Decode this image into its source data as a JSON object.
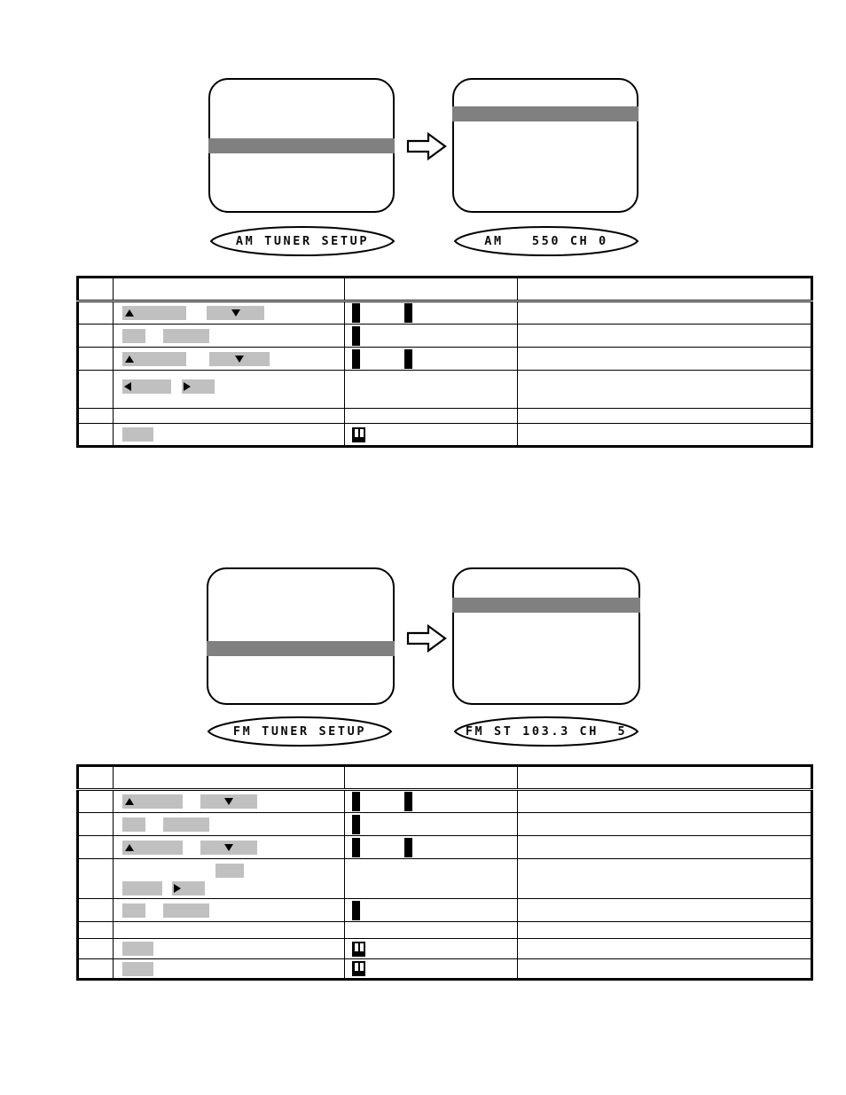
{
  "document": {
    "type": "product-manual-page",
    "background": "#ffffff",
    "accent_gray": "#808080",
    "redaction_gray": "#c0c0c0",
    "line_color": "#000000"
  },
  "sections": [
    {
      "id": "am-tuner",
      "osd": {
        "before": {
          "name": "am-menu-screen-before",
          "screen_lines": [],
          "highlight_bar": {
            "position": "middle",
            "color": "#808080"
          },
          "lcd_readout": "AM TUNER SETUP"
        },
        "transition_icon": "right-arrow-icon",
        "after": {
          "name": "am-menu-screen-after",
          "screen_lines": [],
          "highlight_bar": {
            "position": "upper",
            "color": "#808080"
          },
          "lcd_readout": "AM   550 CH 0"
        }
      },
      "table": {
        "name": "am-tuner-step-table",
        "columns": [
          "",
          "",
          "",
          ""
        ],
        "header": {
          "num": "",
          "action": "",
          "key": "",
          "note": ""
        },
        "rows": [
          {
            "num": "",
            "action": "",
            "key": "",
            "note": "",
            "action_glyphs": [
              "tri-up",
              "blank-wide",
              "tri-down",
              "blank-wide"
            ],
            "key_glyphs": [
              "bar",
              "gap",
              "bar"
            ]
          },
          {
            "num": "",
            "action": "",
            "key": "",
            "note": "",
            "action_glyphs": [
              "blank-small",
              "blank-med"
            ],
            "key_glyphs": [
              "bar"
            ]
          },
          {
            "num": "",
            "action": "",
            "key": "",
            "note": "",
            "action_glyphs": [
              "tri-up",
              "blank-wide",
              "tri-down",
              "blank-wide"
            ],
            "key_glyphs": [
              "bar",
              "gap",
              "bar"
            ]
          },
          {
            "num": "",
            "action": "",
            "key": "",
            "note": "",
            "action_glyphs": [
              "tri-left",
              "blank-med",
              "tri-right",
              "blank-small"
            ],
            "key_glyphs": []
          },
          {
            "num": "",
            "action": "",
            "key": "",
            "note": "",
            "action_glyphs": [],
            "key_glyphs": []
          },
          {
            "num": "",
            "action": "",
            "key": "",
            "note": "",
            "action_glyphs": [
              "blank-small"
            ],
            "key_glyphs": [
              "button"
            ]
          }
        ]
      }
    },
    {
      "id": "fm-tuner",
      "osd": {
        "before": {
          "name": "fm-menu-screen-before",
          "screen_lines": [],
          "highlight_bar": {
            "position": "middle",
            "color": "#808080"
          },
          "lcd_readout": "FM TUNER SETUP"
        },
        "transition_icon": "right-arrow-icon",
        "after": {
          "name": "fm-menu-screen-after",
          "screen_lines": [],
          "highlight_bar": {
            "position": "upper",
            "color": "#808080"
          },
          "lcd_readout": "FM ST 103.3 CH  5"
        }
      },
      "table": {
        "name": "fm-tuner-step-table",
        "columns": [
          "",
          "",
          "",
          ""
        ],
        "header": {
          "num": "",
          "action": "",
          "key": "",
          "note": ""
        },
        "rows": [
          {
            "num": "",
            "action": "",
            "key": "",
            "note": "",
            "action_glyphs": [
              "tri-up",
              "blank-wide",
              "tri-down",
              "blank-wide"
            ],
            "key_glyphs": [
              "bar",
              "gap",
              "bar"
            ]
          },
          {
            "num": "",
            "action": "",
            "key": "",
            "note": "",
            "action_glyphs": [
              "blank-small",
              "blank-med"
            ],
            "key_glyphs": [
              "bar"
            ]
          },
          {
            "num": "",
            "action": "",
            "key": "",
            "note": "",
            "action_glyphs": [
              "tri-up",
              "blank-wide",
              "tri-down",
              "blank-wide"
            ],
            "key_glyphs": [
              "bar",
              "gap",
              "bar"
            ]
          },
          {
            "num": "",
            "action": "",
            "key": "",
            "note": "",
            "action_glyphs": [
              "blank-small-offset",
              "blank-med",
              "tri-right",
              "blank-small"
            ],
            "key_glyphs": []
          },
          {
            "num": "",
            "action": "",
            "key": "",
            "note": "",
            "action_glyphs": [
              "blank-small",
              "blank-med"
            ],
            "key_glyphs": [
              "bar"
            ]
          },
          {
            "num": "",
            "action": "",
            "key": "",
            "note": "",
            "action_glyphs": [],
            "key_glyphs": []
          },
          {
            "num": "",
            "action": "",
            "key": "",
            "note": "",
            "action_glyphs": [
              "blank-small"
            ],
            "key_glyphs": [
              "button"
            ]
          },
          {
            "num": "",
            "action": "",
            "key": "",
            "note": "",
            "action_glyphs": [
              "blank-small"
            ],
            "key_glyphs": [
              "button"
            ]
          }
        ]
      }
    }
  ]
}
